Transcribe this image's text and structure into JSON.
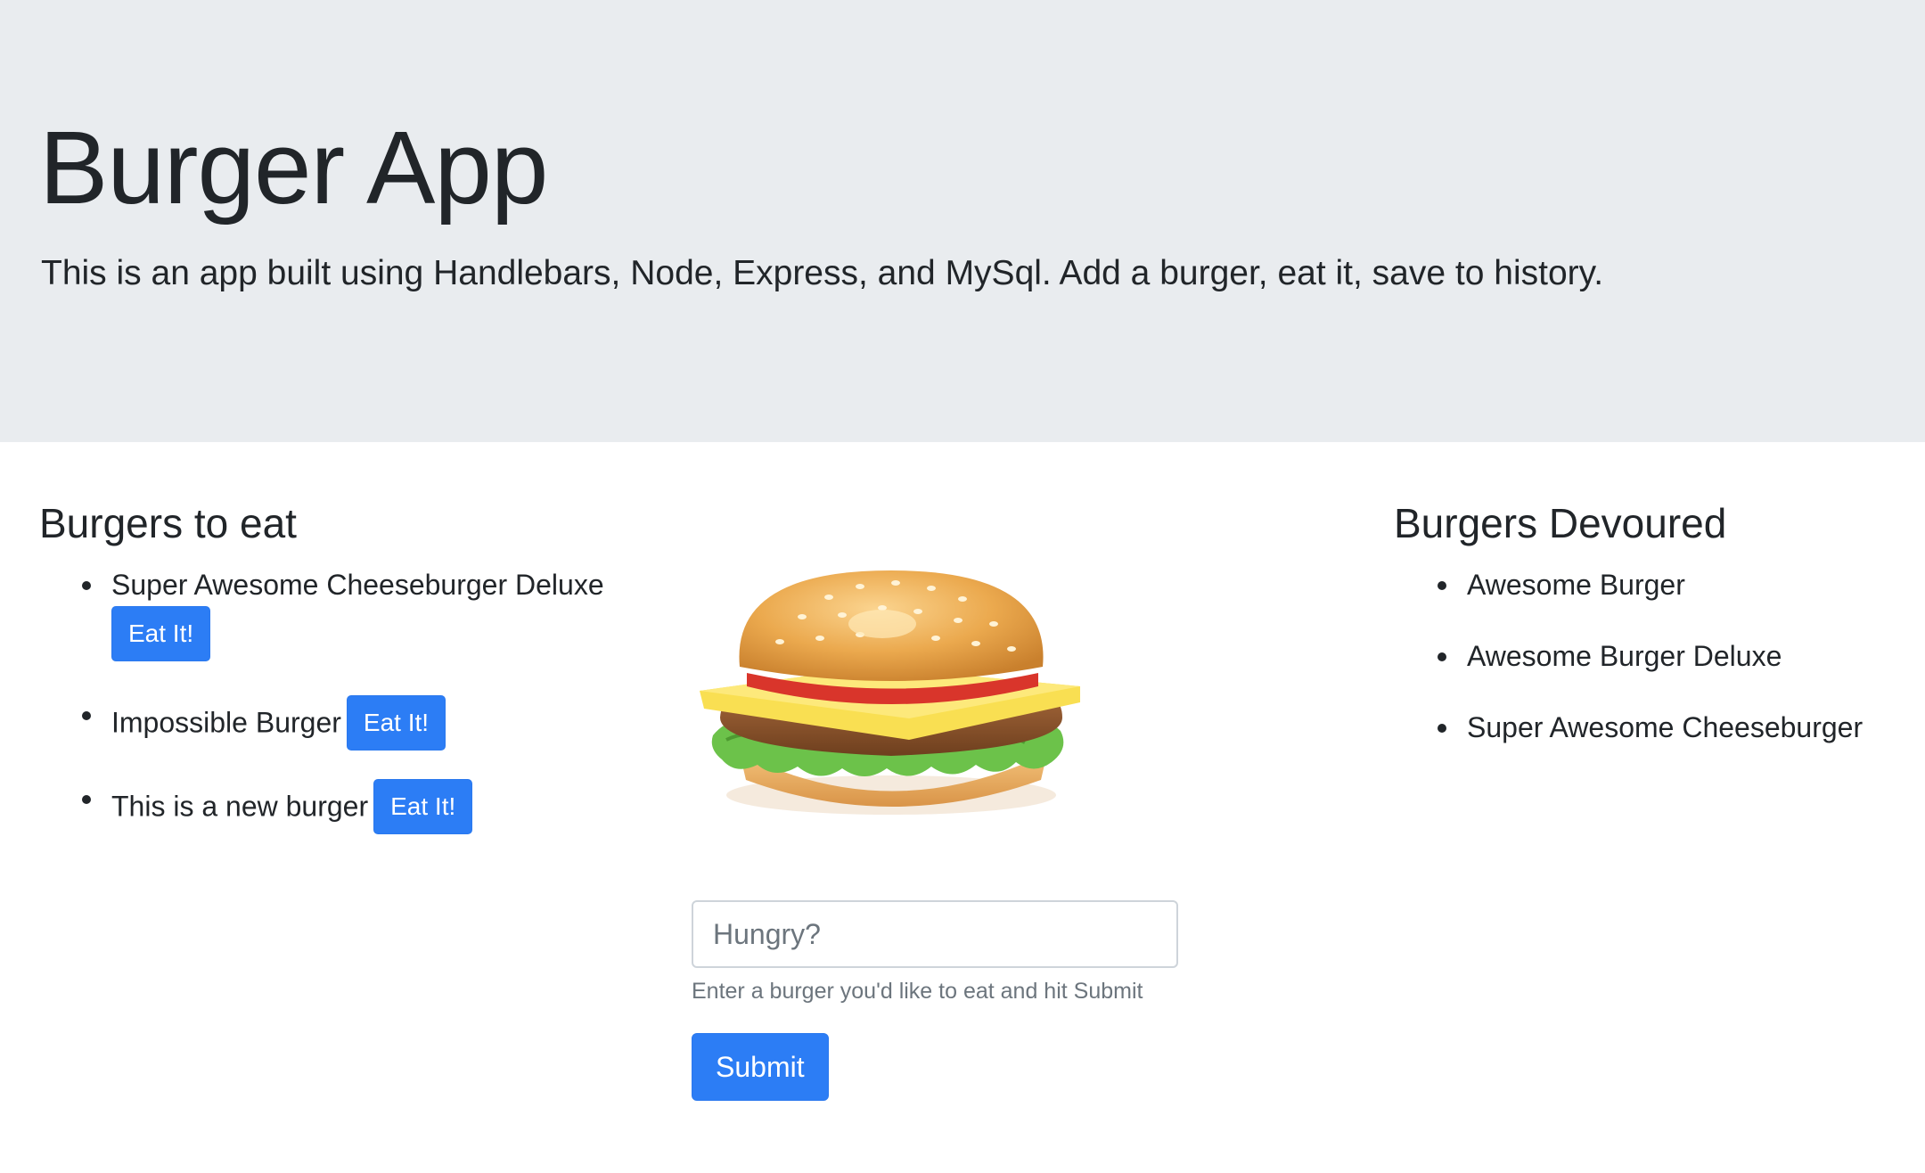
{
  "header": {
    "title": "Burger App",
    "lead": "This is an app built using Handlebars, Node, Express, and MySql. Add a burger, eat it, save to history."
  },
  "to_eat": {
    "heading": "Burgers to eat",
    "button_label": "Eat It!",
    "items": [
      "Super Awesome Cheeseburger Deluxe",
      "Impossible Burger",
      "This is a new burger"
    ]
  },
  "devoured": {
    "heading": "Burgers Devoured",
    "items": [
      "Awesome Burger",
      "Awesome Burger Deluxe",
      "Super Awesome Cheeseburger"
    ]
  },
  "form": {
    "placeholder": "Hungry?",
    "value": "",
    "help": "Enter a burger you'd like to eat and hit Submit",
    "submit_label": "Submit"
  },
  "image": {
    "icon": "hamburger-icon"
  },
  "colors": {
    "jumbotron_bg": "#e9ecef",
    "primary": "#2c7df5",
    "text": "#212529",
    "muted": "#6c757d"
  }
}
